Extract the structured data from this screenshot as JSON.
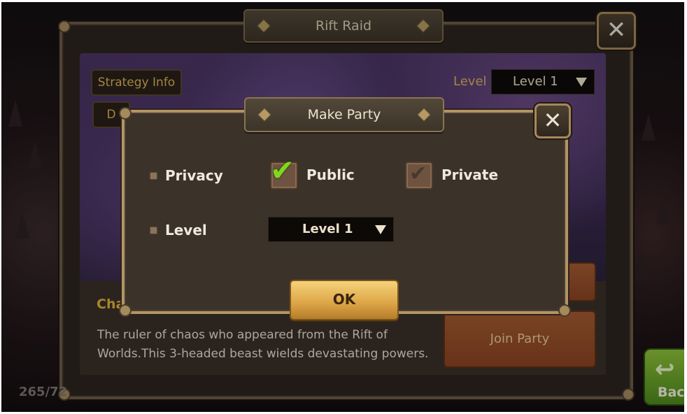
{
  "window": {
    "title": "Rift Raid",
    "close_label": "✕"
  },
  "top_buttons": {
    "strategy_info": "Strategy Info",
    "second_button": "D"
  },
  "level_filter": {
    "label": "Level",
    "selected": "Level 1"
  },
  "boss": {
    "name": "Cha",
    "description_line1": "The ruler of chaos who appeared from the Rift of",
    "description_line2": "Worlds.This 3-headed beast wields devastating powers."
  },
  "actions": {
    "join_party": "Join Party"
  },
  "footer": {
    "counter": "265/72",
    "back_label": "Back"
  },
  "modal": {
    "title": "Make Party",
    "close_label": "✕",
    "privacy": {
      "label": "Privacy",
      "options": [
        {
          "label": "Public",
          "checked": true
        },
        {
          "label": "Private",
          "checked": false
        }
      ]
    },
    "level": {
      "label": "Level",
      "selected": "Level 1"
    },
    "ok_label": "OK"
  },
  "colors": {
    "accent_gold": "#d9b25a",
    "check_green": "#7fd81e",
    "join_orange": "#a35a32"
  }
}
